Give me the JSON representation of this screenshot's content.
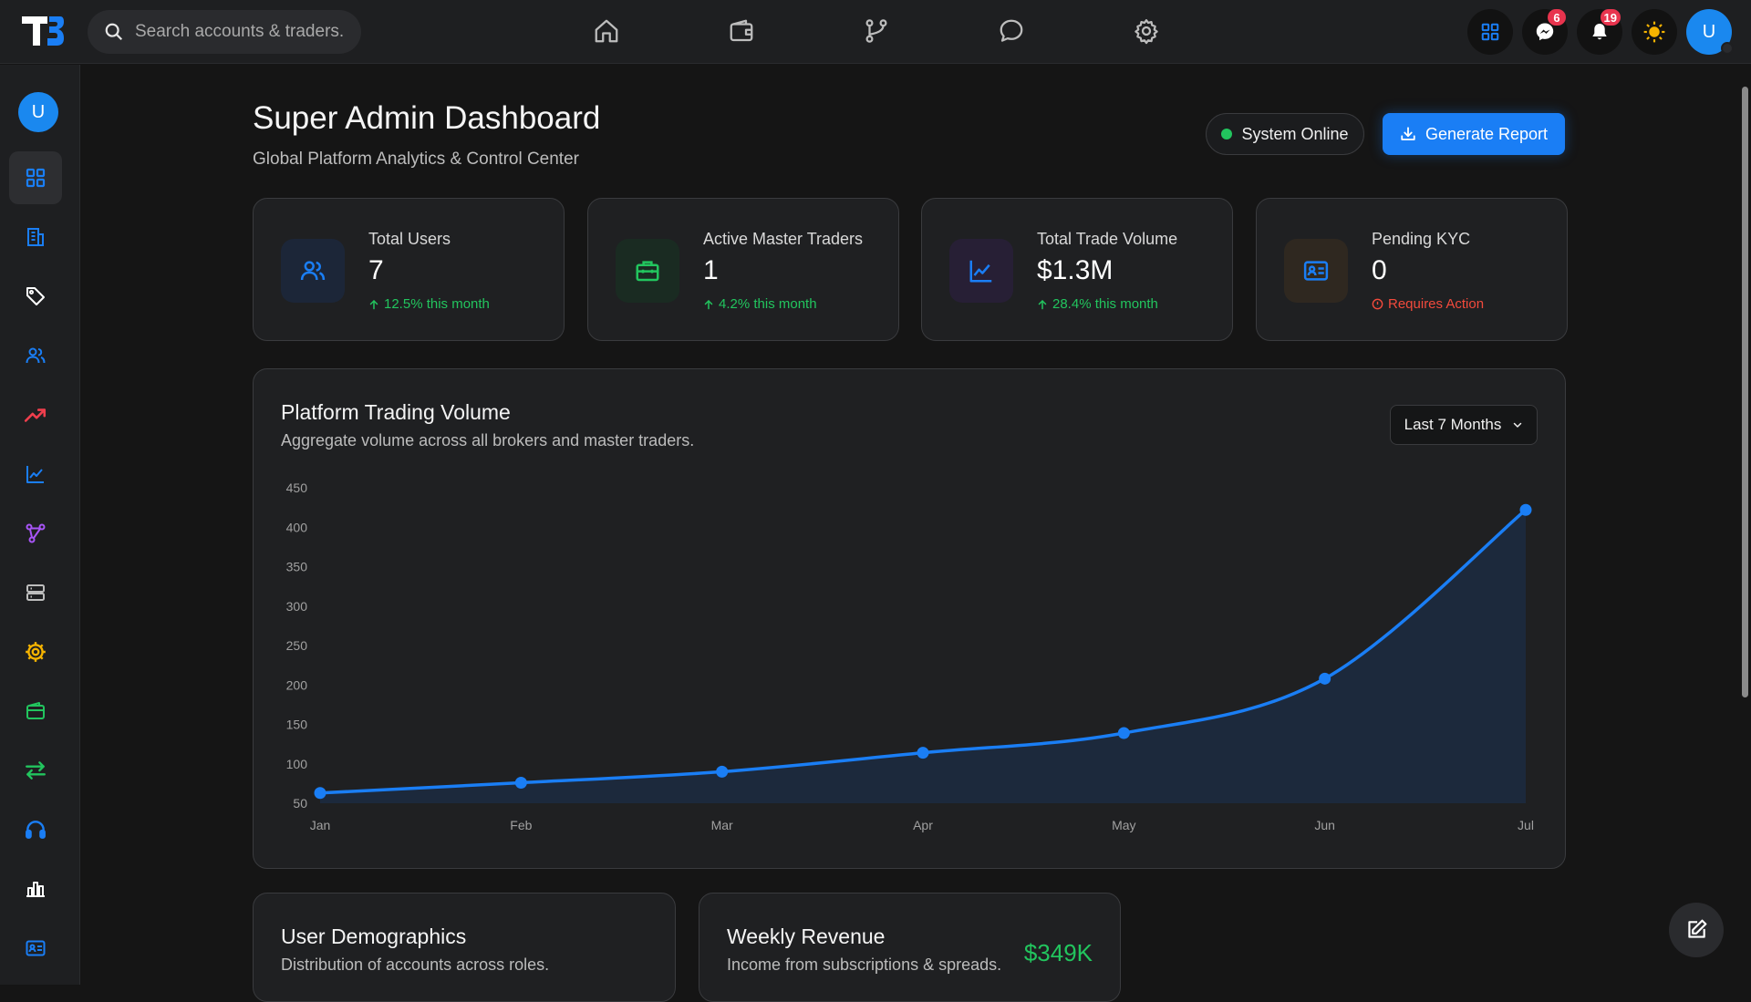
{
  "search": {
    "placeholder": "Search accounts & traders."
  },
  "notifications": {
    "messages_count": "6",
    "alerts_count": "19"
  },
  "user": {
    "initial": "U"
  },
  "header": {
    "title": "Super Admin Dashboard",
    "subtitle": "Global Platform Analytics & Control Center",
    "status": "System Online",
    "report_button": "Generate Report"
  },
  "stats": [
    {
      "label": "Total Users",
      "value": "7",
      "change": "12.5% this month"
    },
    {
      "label": "Active Master Traders",
      "value": "1",
      "change": "4.2% this month"
    },
    {
      "label": "Total Trade Volume",
      "value": "$1.3M",
      "change": "28.4% this month"
    },
    {
      "label": "Pending KYC",
      "value": "0",
      "change": "Requires Action"
    }
  ],
  "volume_chart": {
    "title": "Platform Trading Volume",
    "subtitle": "Aggregate volume across all brokers and master traders.",
    "range_select": "Last 7 Months"
  },
  "chart_data": {
    "type": "area",
    "categories": [
      "Jan",
      "Feb",
      "Mar",
      "Apr",
      "May",
      "Jun",
      "Jul"
    ],
    "values": [
      63,
      76,
      90,
      114,
      139,
      208,
      422
    ],
    "yticks": [
      "450",
      "400",
      "350",
      "300",
      "250",
      "200",
      "150",
      "100",
      "50"
    ],
    "ylim": [
      50,
      450
    ],
    "color": "#1a7ef5"
  },
  "demographics": {
    "title": "User Demographics",
    "subtitle": "Distribution of accounts across roles."
  },
  "revenue": {
    "title": "Weekly Revenue",
    "subtitle": "Income from subscriptions & spreads.",
    "amount": "$349K"
  }
}
